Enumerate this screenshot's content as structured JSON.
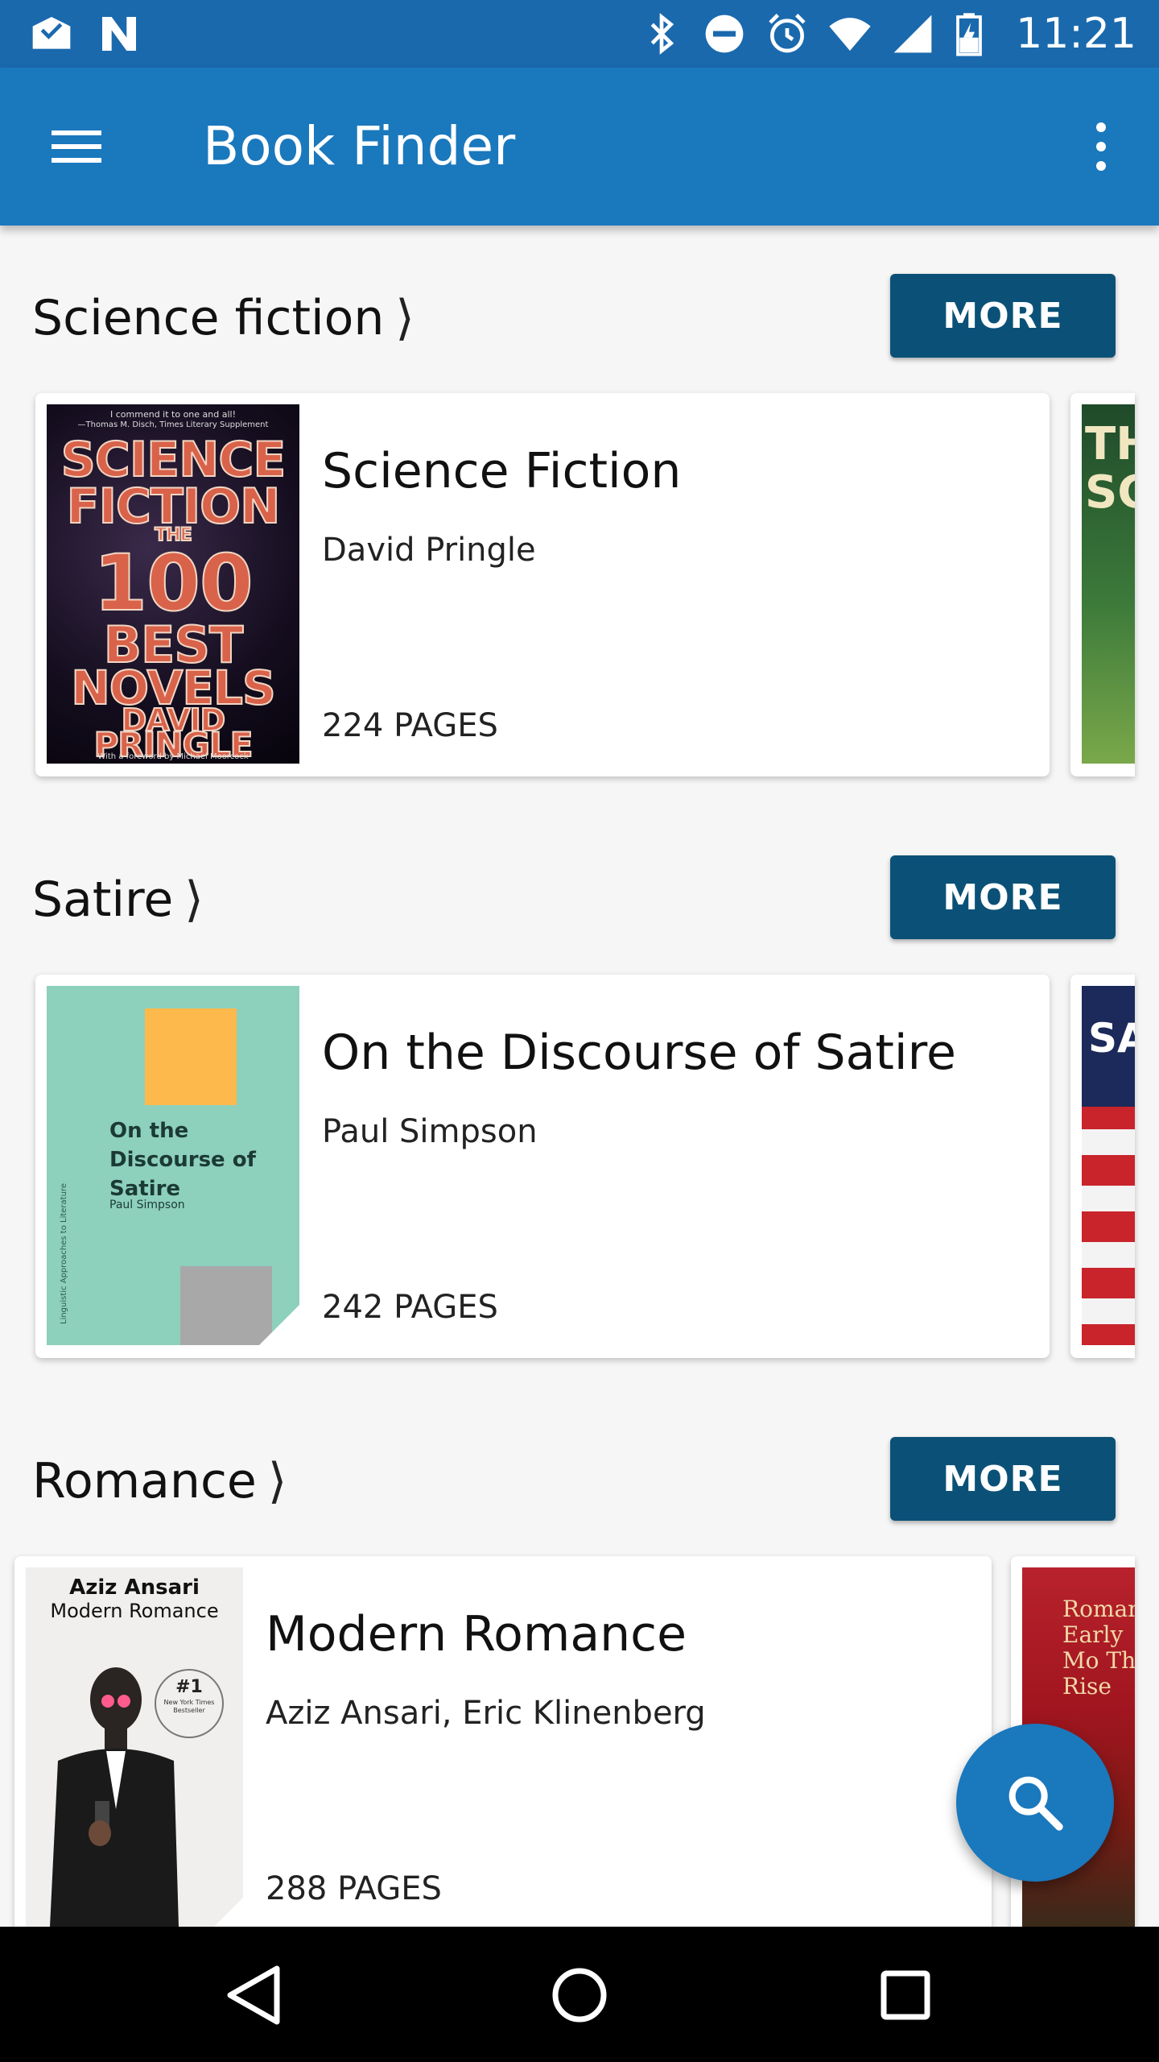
{
  "status_bar": {
    "time": "11:21",
    "left_icons": [
      "mail-check-icon",
      "n-logo-icon"
    ],
    "right_icons": [
      "bluetooth-icon",
      "do-not-disturb-icon",
      "alarm-icon",
      "wifi-icon",
      "signal-icon",
      "battery-charging-icon"
    ]
  },
  "app_bar": {
    "title": "Book Finder",
    "menu_icon": "hamburger-menu-icon",
    "overflow_icon": "more-vert-icon"
  },
  "sections": [
    {
      "title": "Science fiction",
      "chevron": "⟩",
      "more_label": "MORE",
      "book": {
        "title": "Science Fiction",
        "author": "David Pringle",
        "pages": "224 PAGES",
        "cover_text": {
          "quote": "I commend it to one and all!",
          "quote_source": "—Thomas M. Disch, Times Literary Supplement",
          "line1": "SCIENCE",
          "line2": "FICTION",
          "line3": "THE",
          "line4": "100",
          "line5": "BEST",
          "line6": "NOVELS",
          "line7": "DAVID",
          "line8": "PRINGLE",
          "foreword": "With a foreword by Michael Moorcock"
        }
      },
      "peek_cover_text": "THE SCI"
    },
    {
      "title": "Satire",
      "chevron": "⟩",
      "more_label": "MORE",
      "book": {
        "title": "On the Discourse of Satire",
        "author": "Paul Simpson",
        "pages": "242 PAGES",
        "cover_text": {
          "title": "On the Discourse of Satire",
          "author": "Paul Simpson",
          "spine": "Linguistic Approaches to Literature"
        }
      },
      "peek_cover_text": "SA"
    },
    {
      "title": "Romance",
      "chevron": "⟩",
      "more_label": "MORE",
      "book": {
        "title": "Modern Romance",
        "author": "Aziz Ansari, Eric Klinenberg",
        "pages": "288 PAGES",
        "cover_text": {
          "author": "Aziz Ansari",
          "title": "Modern Romance",
          "badge_number": "#1",
          "badge_text": "New York Times Bestseller"
        }
      },
      "peek_cover_text": "Romance Early Mo The Rise"
    }
  ],
  "fab": {
    "icon": "search-icon"
  },
  "nav_bar": {
    "icons": [
      "back-icon",
      "home-icon",
      "recents-icon"
    ]
  },
  "colors": {
    "status_bar": "#1a69ad",
    "app_bar": "#1a78bd",
    "more_button": "#0b5177",
    "fab": "#1a78bd"
  }
}
